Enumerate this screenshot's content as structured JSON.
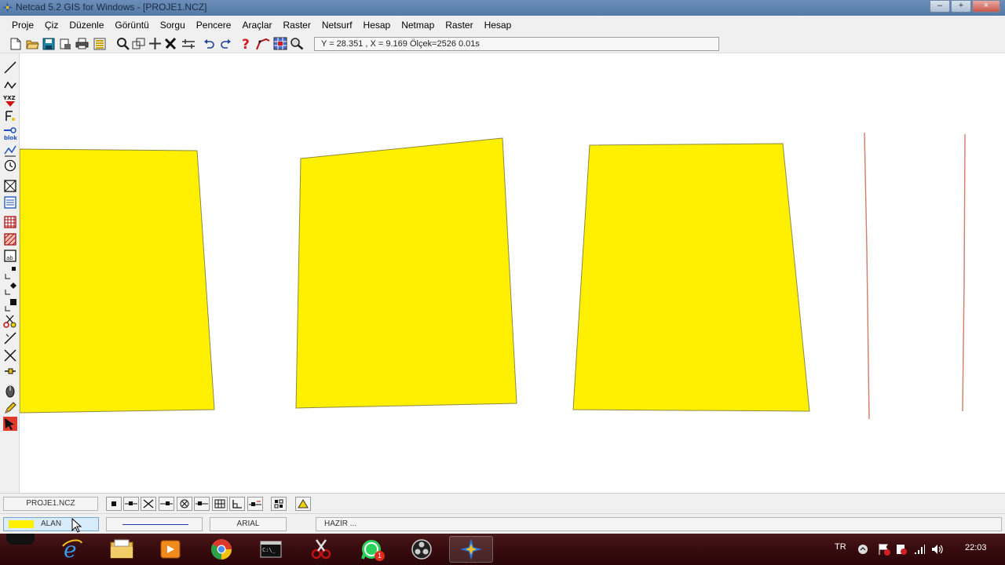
{
  "window": {
    "title": "Netcad 5.2 GIS for Windows - [PROJE1.NCZ]",
    "buttons": [
      "–",
      "+",
      "×"
    ]
  },
  "menu": [
    "Proje",
    "Çiz",
    "Düzenle",
    "Görüntü",
    "Sorgu",
    "Pencere",
    "Araçlar",
    "Raster",
    "Netsurf",
    "Hesap",
    "Netmap",
    "Raster",
    "Hesap"
  ],
  "status": {
    "coords": "Y = 28.351 , X = 9.169  Ölçek=2526   0.01s"
  },
  "icons": {
    "toolbar": [
      "new-file-icon",
      "open-folder-icon",
      "save-icon",
      "print-preview-icon",
      "print-icon",
      "layers-icon",
      "zoom-icon",
      "zoom-window-icon",
      "pan-icon",
      "erase-icon",
      "move-icon",
      "undo-icon",
      "redo-icon",
      "help-icon",
      "polyline-icon",
      "raster-grid-icon",
      "find-icon"
    ],
    "left": [
      "line-icon",
      "polyline-icon",
      "xyz-point-icon",
      "text-icon",
      "block-icon",
      "profile-icon",
      "clock-icon",
      "box-icon",
      "list-icon",
      "grid-icon",
      "hatch-icon",
      "text-box-icon",
      "node-small-icon",
      "node-diamond-icon",
      "node-large-icon",
      "scissors-icon",
      "slash-icon",
      "cross-icon",
      "segment-icon",
      "mouse-icon",
      "pencil-icon",
      "select-arrow-icon"
    ]
  },
  "drawing": {
    "fill": "#ffef00",
    "stroke": "#8c8a40",
    "line_color": "#d47b6a"
  },
  "bottom": {
    "project": "PROJE1.NCZ",
    "layer": "ALAN",
    "font": "ARIAL",
    "state": "HAZIR ..."
  },
  "taskbar": {
    "apps": [
      "ie-icon",
      "explorer-icon",
      "media-player-icon",
      "chrome-icon",
      "cmd-icon",
      "snipping-tool-icon",
      "whatsapp-icon",
      "obs-icon",
      "netcad-icon"
    ],
    "whatsapp_badge": "1",
    "lang": "TR",
    "time": "22:03"
  }
}
